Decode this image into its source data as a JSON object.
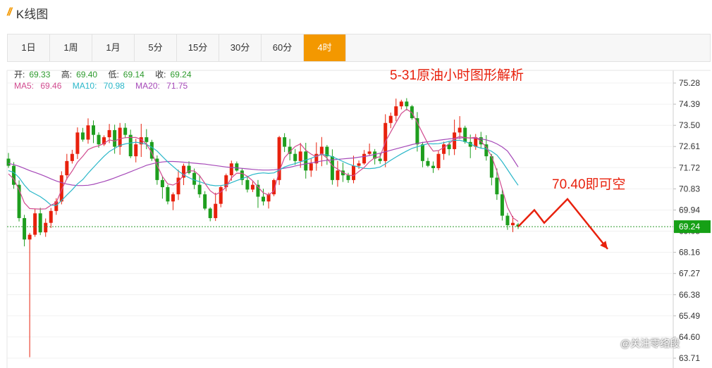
{
  "header": {
    "title": "K线图",
    "icon": "stripes-icon"
  },
  "tabs": [
    {
      "label": "1日",
      "active": false
    },
    {
      "label": "1周",
      "active": false
    },
    {
      "label": "1月",
      "active": false
    },
    {
      "label": "5分",
      "active": false
    },
    {
      "label": "15分",
      "active": false
    },
    {
      "label": "30分",
      "active": false
    },
    {
      "label": "60分",
      "active": false
    },
    {
      "label": "4时",
      "active": true
    }
  ],
  "info": {
    "open_label": "开:",
    "open": "69.33",
    "high_label": "高:",
    "high": "69.40",
    "low_label": "低:",
    "low": "69.14",
    "close_label": "收:",
    "close": "69.24",
    "ma5_label": "MA5:",
    "ma5": "69.46",
    "ma10_label": "MA10:",
    "ma10": "70.98",
    "ma20_label": "MA20:",
    "ma20": "71.75"
  },
  "annotation": {
    "title": "5-31原油小时图形解析",
    "price_text": "70.40即可空",
    "arrow_color": "#e8210d"
  },
  "watermark": "@关注零络段",
  "colors": {
    "up": "#e8210d",
    "down": "#1e9e1e",
    "accent": "#f39800",
    "ma5": "#d14b8f",
    "ma10": "#2ab7c9",
    "ma20": "#a548b8"
  },
  "chart_data": {
    "type": "candlestick",
    "yticks": [
      "75.28",
      "74.39",
      "73.50",
      "72.61",
      "71.72",
      "70.83",
      "69.94",
      "69.05",
      "68.16",
      "67.27",
      "66.38",
      "65.49",
      "64.60",
      "63.71"
    ],
    "ylim": [
      63.71,
      75.28
    ],
    "current_price": "69.24",
    "close_path": [
      71.8,
      71.0,
      69.6,
      68.7,
      68.9,
      69.8,
      69.0,
      69.4,
      69.9,
      70.3,
      71.4,
      72.0,
      72.3,
      73.2,
      72.9,
      73.5,
      73.1,
      72.7,
      73.0,
      73.3,
      72.6,
      73.4,
      73.1,
      72.2,
      72.7,
      73.0,
      72.8,
      72.1,
      71.2,
      70.9,
      70.3,
      70.6,
      71.3,
      71.8,
      71.5,
      71.0,
      70.6,
      70.0,
      69.6,
      70.2,
      70.9,
      71.4,
      71.9,
      71.6,
      71.2,
      70.8,
      71.0,
      70.5,
      70.3,
      70.6,
      71.2,
      73.0,
      72.6,
      72.3,
      72.0,
      72.4,
      71.6,
      71.9,
      72.3,
      72.6,
      72.2,
      71.2,
      71.6,
      71.4,
      71.2,
      71.8,
      71.9,
      72.3,
      72.4,
      72.1,
      72.0,
      73.6,
      73.9,
      74.3,
      74.5,
      74.3,
      73.8,
      72.7,
      72.0,
      71.8,
      71.7,
      72.3,
      72.7,
      72.5,
      73.2,
      73.4,
      72.8,
      72.6,
      73.0,
      72.7,
      72.2,
      71.3,
      70.6,
      69.7,
      69.3,
      69.4,
      69.2
    ],
    "ma5": [
      71.46,
      71.24,
      70.79,
      70.24,
      70.0,
      69.99,
      69.98,
      69.99,
      70.14,
      70.25,
      70.79,
      71.26,
      71.58,
      71.95,
      72.2,
      72.48,
      72.58,
      72.64,
      72.74,
      72.89,
      72.84,
      72.94,
      72.98,
      72.99,
      72.99,
      72.91,
      72.71,
      72.35,
      71.82,
      71.35,
      71.04,
      70.99,
      71.11,
      71.42,
      71.59,
      71.58,
      71.39,
      71.06,
      70.75,
      70.59,
      70.7,
      70.91,
      71.29,
      71.49,
      71.48,
      71.36,
      71.17,
      70.91,
      70.66,
      70.57,
      70.74,
      71.57,
      72.14,
      72.39,
      72.61,
      72.72,
      72.45,
      72.29,
      72.18,
      72.31,
      72.12,
      71.8,
      71.66,
      71.51,
      71.41,
      71.38,
      71.56,
      71.73,
      71.97,
      72.14,
      72.18,
      72.81,
      73.22,
      73.62,
      74.0,
      74.18,
      74.03,
      73.62,
      73.17,
      72.73,
      72.42,
      72.44,
      72.57,
      72.72,
      72.94,
      73.04,
      72.98,
      72.97,
      73.0,
      72.83,
      72.58,
      72.2,
      71.58,
      70.82,
      70.05,
      69.62,
      69.46
    ],
    "ma10": [
      71.6,
      71.52,
      71.3,
      70.99,
      70.74,
      70.62,
      70.5,
      70.34,
      70.15,
      70.13,
      70.34,
      70.57,
      70.79,
      71.04,
      71.22,
      71.49,
      71.73,
      71.97,
      72.2,
      72.4,
      72.53,
      72.66,
      72.72,
      72.76,
      72.79,
      72.76,
      72.7,
      72.58,
      72.42,
      72.19,
      71.97,
      71.77,
      71.58,
      71.42,
      71.3,
      71.2,
      71.13,
      71.05,
      70.99,
      70.96,
      70.97,
      71.0,
      71.09,
      71.18,
      71.26,
      71.34,
      71.43,
      71.48,
      71.5,
      71.48,
      71.5,
      71.62,
      71.75,
      71.83,
      71.89,
      71.97,
      72.04,
      72.11,
      72.21,
      72.27,
      72.26,
      72.18,
      72.08,
      71.98,
      71.88,
      71.8,
      71.75,
      71.69,
      71.68,
      71.7,
      71.75,
      71.88,
      72.03,
      72.17,
      72.3,
      72.42,
      72.53,
      72.6,
      72.66,
      72.73,
      72.72,
      72.73,
      72.77,
      72.83,
      72.87,
      72.87,
      72.82,
      72.72,
      72.61,
      72.54,
      72.51,
      72.41,
      72.25,
      71.97,
      71.64,
      71.3,
      70.98
    ],
    "ma20": [
      71.9,
      71.85,
      71.78,
      71.69,
      71.6,
      71.52,
      71.44,
      71.35,
      71.25,
      71.16,
      71.09,
      71.03,
      70.99,
      70.97,
      70.97,
      70.98,
      71.02,
      71.08,
      71.14,
      71.21,
      71.29,
      71.38,
      71.46,
      71.55,
      71.64,
      71.73,
      71.82,
      71.88,
      71.93,
      71.96,
      71.98,
      71.98,
      71.97,
      71.95,
      71.93,
      71.91,
      71.89,
      71.87,
      71.84,
      71.81,
      71.78,
      71.75,
      71.73,
      71.71,
      71.69,
      71.67,
      71.65,
      71.63,
      71.62,
      71.62,
      71.63,
      71.66,
      71.7,
      71.74,
      71.79,
      71.84,
      71.88,
      71.92,
      71.96,
      72.0,
      72.03,
      72.05,
      72.07,
      72.09,
      72.11,
      72.13,
      72.16,
      72.19,
      72.23,
      72.28,
      72.33,
      72.39,
      72.45,
      72.51,
      72.57,
      72.63,
      72.69,
      72.74,
      72.78,
      72.81,
      72.84,
      72.87,
      72.9,
      72.93,
      72.95,
      72.97,
      72.98,
      72.97,
      72.96,
      72.93,
      72.89,
      72.82,
      72.72,
      72.59,
      72.42,
      72.1,
      71.75
    ],
    "last_candle": {
      "open": 69.33,
      "high": 69.4,
      "low": 69.14,
      "close": 69.24
    },
    "projection": [
      69.24,
      69.94,
      69.4,
      70.4,
      68.3
    ],
    "projection_label": "70.40即可空"
  }
}
